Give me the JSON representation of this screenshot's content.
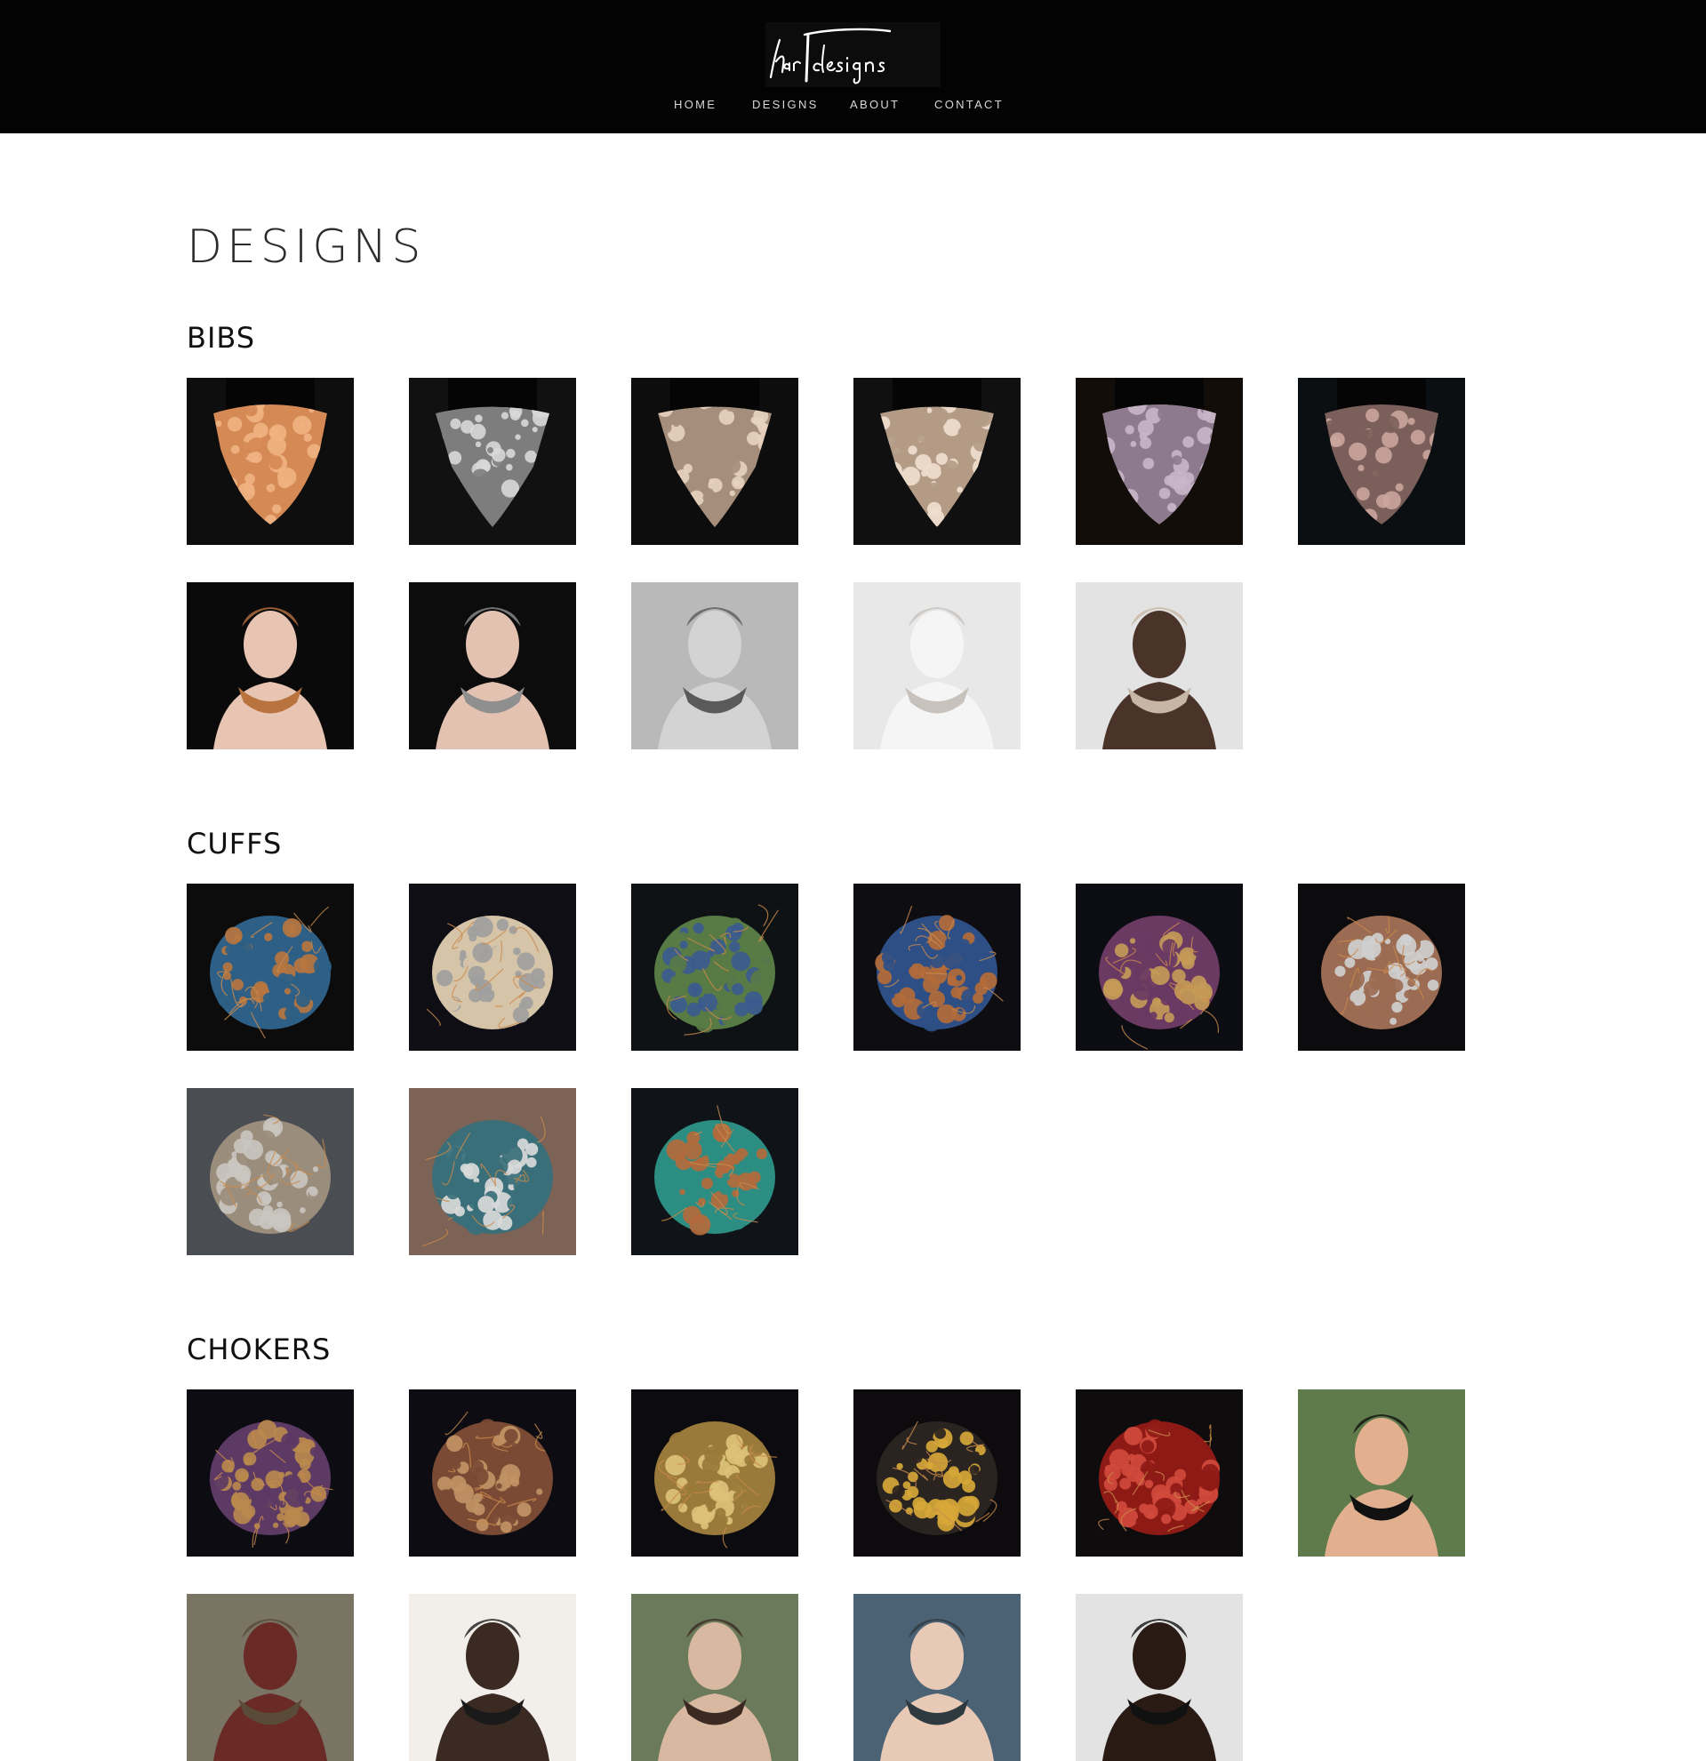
{
  "header": {
    "logo_text": "harT designs",
    "nav": [
      {
        "label": "HOME"
      },
      {
        "label": "DESIGNS"
      },
      {
        "label": "ABOUT"
      },
      {
        "label": "CONTACT"
      }
    ]
  },
  "page": {
    "title": "DESIGNS"
  },
  "colors": {
    "header_bg": "#030303",
    "nav_text": "#d8d8d8",
    "page_bg": "#ffffff",
    "heading": "#111111"
  },
  "sections": [
    {
      "title": "BIBS",
      "items": [
        {
          "kind": "bib",
          "bg": "#0e0e0e",
          "c1": "#d58a55",
          "c2": "#f1b283",
          "shape": "heart"
        },
        {
          "kind": "bib",
          "bg": "#111111",
          "c1": "#7d7d7d",
          "c2": "#d8d8d8",
          "shape": "vee"
        },
        {
          "kind": "bib",
          "bg": "#0d0d0d",
          "c1": "#a58f7c",
          "c2": "#e8d3c0",
          "shape": "vee"
        },
        {
          "kind": "bib",
          "bg": "#101010",
          "c1": "#b39b86",
          "c2": "#efdfcf",
          "shape": "vee"
        },
        {
          "kind": "bib",
          "bg": "#120d08",
          "c1": "#8e7a8d",
          "c2": "#c9b6c9",
          "shape": "heart"
        },
        {
          "kind": "bib",
          "bg": "#0b0f12",
          "c1": "#7b5f5a",
          "c2": "#caa59c",
          "shape": "heart"
        },
        {
          "kind": "portrait",
          "bg": "#0a0a0a",
          "c1": "#e8c4b3",
          "c2": "#b8733f"
        },
        {
          "kind": "portrait",
          "bg": "#0c0c0c",
          "c1": "#e4c2b2",
          "c2": "#8f8f8f"
        },
        {
          "kind": "portrait",
          "bg": "#b9b9b9",
          "c1": "#d3d3d3",
          "c2": "#5a5a5a"
        },
        {
          "kind": "portrait",
          "bg": "#e8e8e8",
          "c1": "#f5f5f5",
          "c2": "#c7c2bc"
        },
        {
          "kind": "portrait",
          "bg": "#e3e3e3",
          "c1": "#4a3328",
          "c2": "#c7b6a5"
        }
      ]
    },
    {
      "title": "CUFFS",
      "items": [
        {
          "kind": "cuff",
          "bg": "#0c0c0c",
          "c1": "#2e5f86",
          "c2": "#b7763f"
        },
        {
          "kind": "cuff",
          "bg": "#0e0e14",
          "c1": "#d6c4a9",
          "c2": "#9e9e9e"
        },
        {
          "kind": "cuff",
          "bg": "#0f1214",
          "c1": "#587a45",
          "c2": "#3b5b8e"
        },
        {
          "kind": "cuff",
          "bg": "#0d0d12",
          "c1": "#2e4f86",
          "c2": "#b46b3a"
        },
        {
          "kind": "cuff",
          "bg": "#0c0d12",
          "c1": "#6a3a63",
          "c2": "#c49a57"
        },
        {
          "kind": "cuff",
          "bg": "#0c0c0e",
          "c1": "#9b6b53",
          "c2": "#cfcfcf"
        },
        {
          "kind": "cuff",
          "bg": "#4a4d52",
          "c1": "#9b8d7b",
          "c2": "#c9c5bf"
        },
        {
          "kind": "cuff",
          "bg": "#7d6256",
          "c1": "#3a6f7a",
          "c2": "#d9d9d9"
        },
        {
          "kind": "cuff",
          "bg": "#101418",
          "c1": "#2c8d82",
          "c2": "#b36a3c"
        }
      ]
    },
    {
      "title": "CHOKERS",
      "items": [
        {
          "kind": "cuff",
          "bg": "#0d0c12",
          "c1": "#5c3a64",
          "c2": "#b8894d"
        },
        {
          "kind": "cuff",
          "bg": "#0c0c12",
          "c1": "#7a4a34",
          "c2": "#c09264"
        },
        {
          "kind": "cuff",
          "bg": "#0c0c10",
          "c1": "#9a7a3a",
          "c2": "#dcc17a"
        },
        {
          "kind": "cuff",
          "bg": "#0d0b0d",
          "c1": "#2a2420",
          "c2": "#d7a838"
        },
        {
          "kind": "cuff",
          "bg": "#0e0c0c",
          "c1": "#8e1a16",
          "c2": "#d04a3c"
        },
        {
          "kind": "portrait",
          "bg": "#5f7a4b",
          "c1": "#e2b08f",
          "c2": "#111111"
        },
        {
          "kind": "portrait",
          "bg": "#7a7465",
          "c1": "#6a2a26",
          "c2": "#5a4a38"
        },
        {
          "kind": "portrait",
          "bg": "#f2efea",
          "c1": "#3a2a22",
          "c2": "#1a1a1a"
        },
        {
          "kind": "portrait",
          "bg": "#6a7a5a",
          "c1": "#d9b8a1",
          "c2": "#3a2a22"
        },
        {
          "kind": "portrait",
          "bg": "#4a6274",
          "c1": "#e8c9b5",
          "c2": "#2e3a40"
        },
        {
          "kind": "portrait",
          "bg": "#e3e3e3",
          "c1": "#2a1a14",
          "c2": "#111111"
        }
      ]
    }
  ]
}
